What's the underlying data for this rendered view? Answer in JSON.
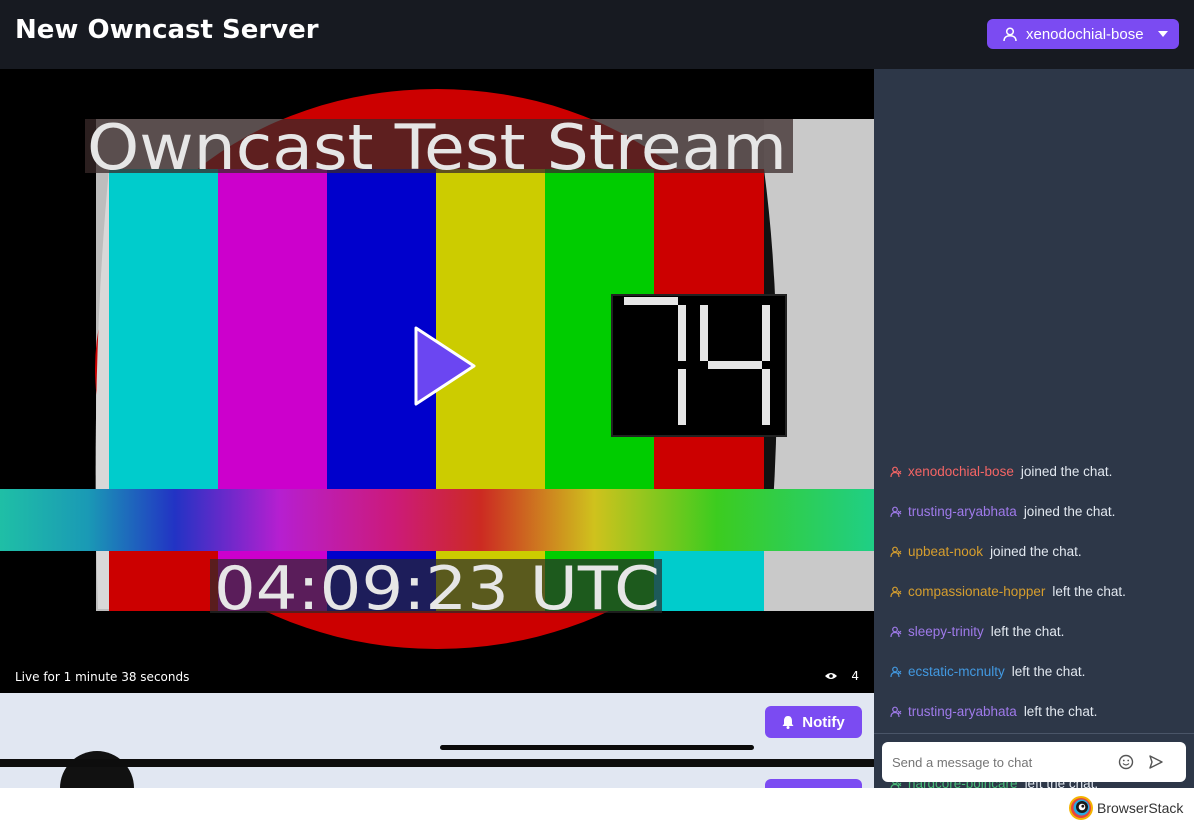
{
  "header": {
    "title": "New Owncast Server",
    "user_menu": {
      "label": "xenodochial-bose",
      "icon": "user-icon",
      "caret_icon": "caret-down-icon"
    }
  },
  "video": {
    "overlay_title": "Owncast Test Stream",
    "counter": "14",
    "timestamp": "04:09:23 UTC",
    "play_icon": "play-icon",
    "live_status": "Live for 1 minute 38 seconds",
    "viewer_icon": "eye-icon",
    "viewer_count": "4"
  },
  "actions": {
    "notify_label": "Notify",
    "notify_icon": "bell-icon"
  },
  "chat": {
    "messages": [
      {
        "user": "xenodochial-bose",
        "text": "joined the chat.",
        "color": "#f56565"
      },
      {
        "user": "trusting-aryabhata",
        "text": "joined the chat.",
        "color": "#9f7aea"
      },
      {
        "user": "upbeat-nook",
        "text": "joined the chat.",
        "color": "#d69e2e"
      },
      {
        "user": "compassionate-hopper",
        "text": "left the chat.",
        "color": "#d69e2e"
      },
      {
        "user": "sleepy-trinity",
        "text": "left the chat.",
        "color": "#9f7aea"
      },
      {
        "user": "ecstatic-mcnulty",
        "text": "left the chat.",
        "color": "#4299e1"
      },
      {
        "user": "trusting-aryabhata",
        "text": "left the chat.",
        "color": "#9f7aea"
      },
      {
        "user": "hardcore-poincare",
        "text": "left the chat.",
        "color": "#48bb78"
      }
    ],
    "message_icon": "chat-user-icon",
    "input_placeholder": "Send a message to chat",
    "emoji_icon": "emoji-icon",
    "send_icon": "send-icon"
  },
  "footer": {
    "brand": "BrowserStack"
  },
  "colors": {
    "accent": "#7b4bf2",
    "header_bg": "#171a21",
    "chat_bg": "#2d3748",
    "below_bg": "#e1e7f2"
  }
}
